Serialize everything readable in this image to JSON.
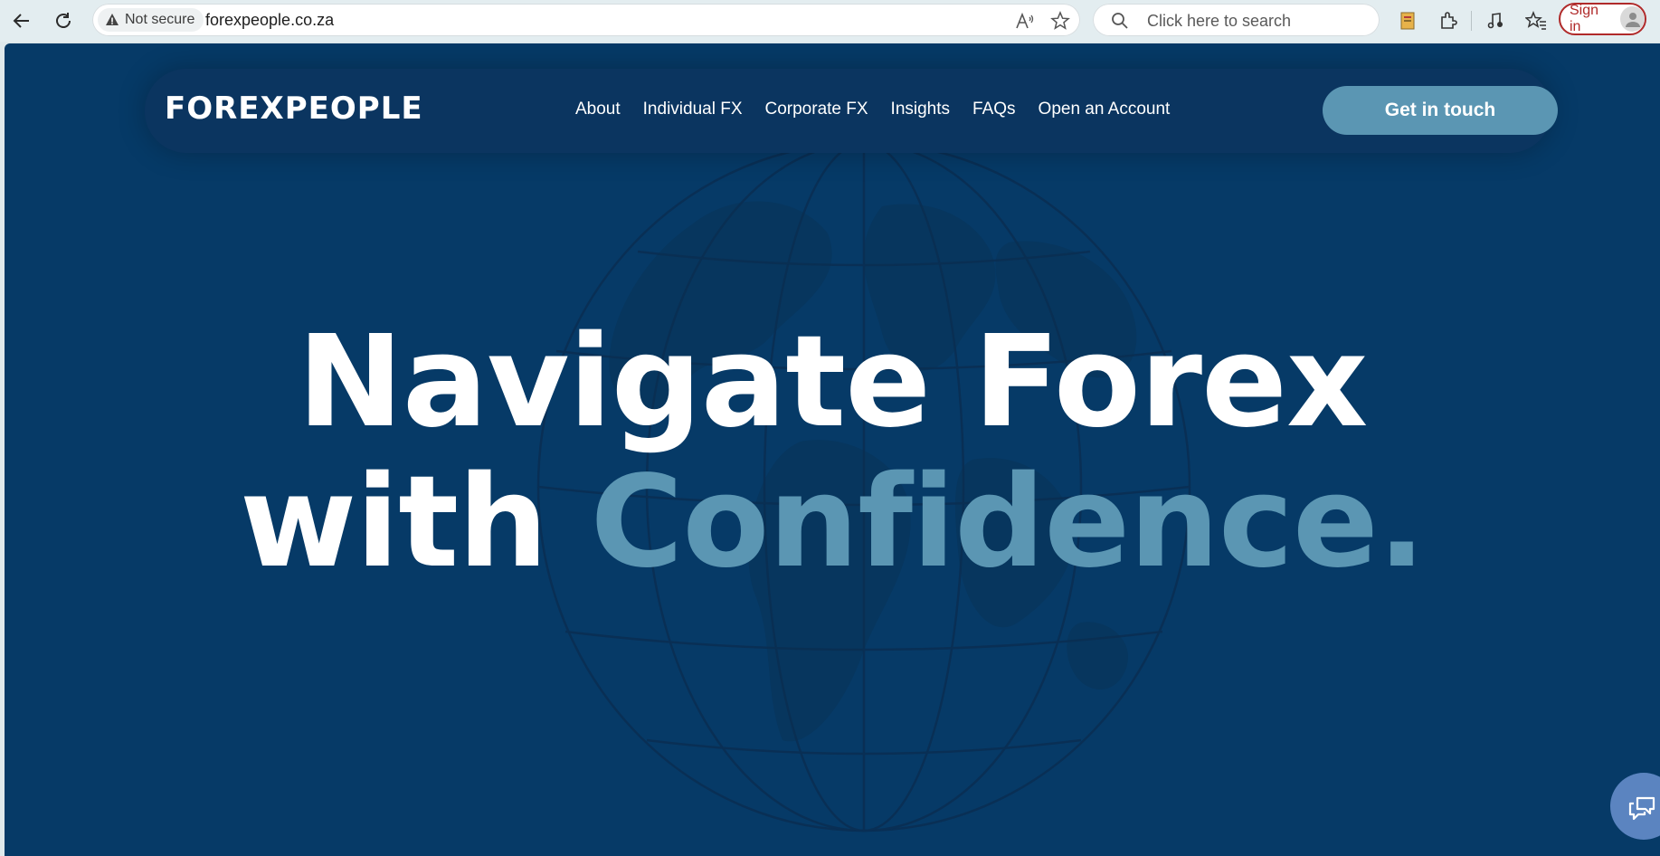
{
  "browser": {
    "security_label": "Not secure",
    "url": "forexpeople.co.za",
    "search_placeholder": "Click here to search",
    "signin_label": "Sign in",
    "icons": [
      "back-icon",
      "refresh-icon",
      "warning-icon",
      "read-aloud-icon",
      "favorite-star-icon",
      "search-icon",
      "collections-icon",
      "extensions-icon",
      "media-icon",
      "favorites-icon",
      "profile-icon"
    ]
  },
  "site": {
    "logo_text": "FOREXPEOPLE",
    "nav": [
      {
        "label": "About"
      },
      {
        "label": "Individual FX"
      },
      {
        "label": "Corporate FX"
      },
      {
        "label": "Insights"
      },
      {
        "label": "FAQs"
      },
      {
        "label": "Open an Account"
      }
    ],
    "cta_label": "Get in touch",
    "hero": {
      "line1": "Navigate Forex",
      "line2_prefix": "with ",
      "line2_accent": "Confidence."
    },
    "colors": {
      "background": "#063a67",
      "header": "#0b3560",
      "accent": "#5b96b3",
      "chat_button": "#5b84c0"
    }
  }
}
